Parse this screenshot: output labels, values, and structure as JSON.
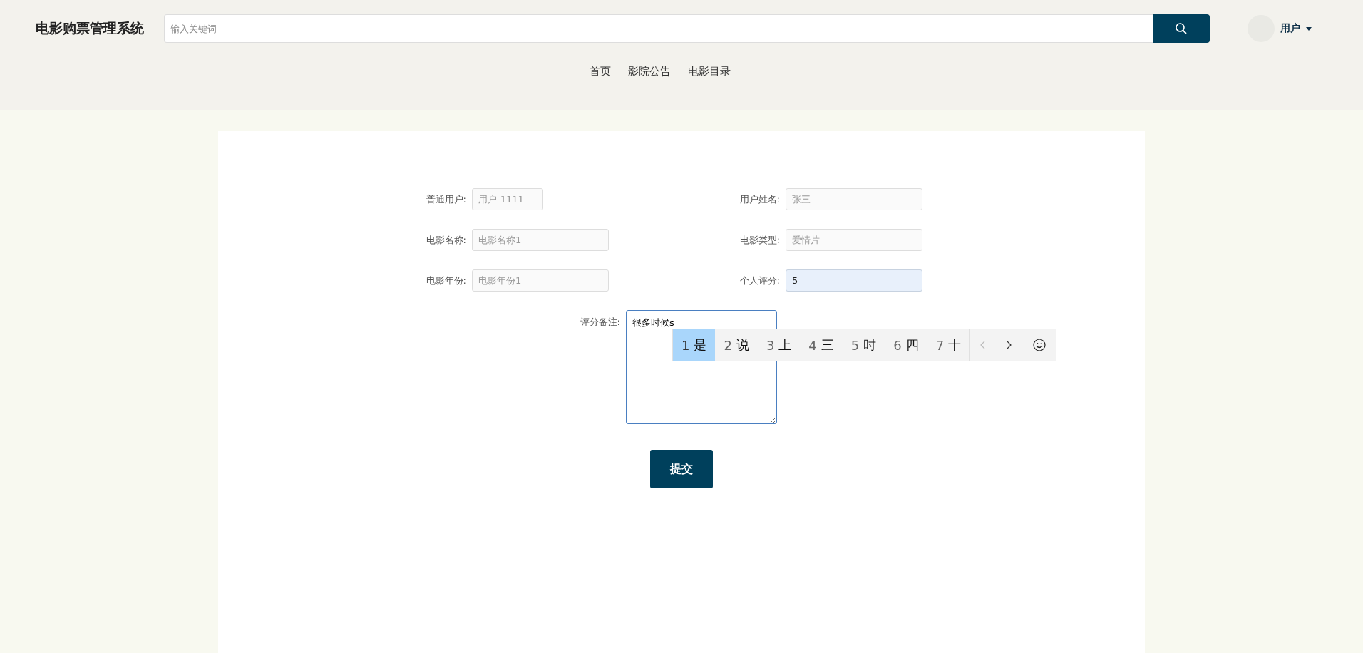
{
  "header": {
    "logo": "电影购票管理系统",
    "search": {
      "placeholder": "输入关键词"
    },
    "user": {
      "name": "用户"
    }
  },
  "nav": [
    "首页",
    "影院公告",
    "电影目录"
  ],
  "form": {
    "fields": [
      {
        "label": "普通用户:",
        "placeholder": "用户-1111"
      },
      {
        "label": "用户姓名:",
        "placeholder": "张三"
      },
      {
        "label": "电影名称:",
        "placeholder": "电影名称1"
      },
      {
        "label": "电影类型:",
        "placeholder": "爱情片"
      },
      {
        "label": "电影年份:",
        "placeholder": "电影年份1"
      },
      {
        "label": "个人评分:",
        "value": "5"
      }
    ],
    "remark": {
      "label": "评分备注:",
      "value": "很多时候s"
    },
    "submit": "提交"
  },
  "ime": {
    "candidates": [
      {
        "number": "1",
        "text": "是",
        "selected": true
      },
      {
        "number": "2",
        "text": "说",
        "selected": false
      },
      {
        "number": "3",
        "text": "上",
        "selected": false
      },
      {
        "number": "4",
        "text": "三",
        "selected": false
      },
      {
        "number": "5",
        "text": "时",
        "selected": false
      },
      {
        "number": "6",
        "text": "四",
        "selected": false
      },
      {
        "number": "7",
        "text": "十",
        "selected": false
      }
    ]
  }
}
